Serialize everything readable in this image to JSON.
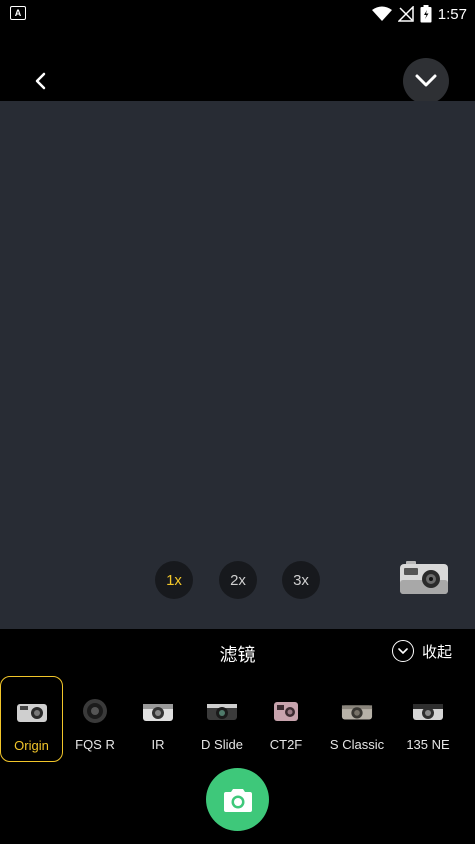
{
  "status_bar": {
    "time": "1:57",
    "left_badge": "A"
  },
  "zoom": {
    "options": [
      "1x",
      "2x",
      "3x"
    ],
    "selected": "1x"
  },
  "panel": {
    "title": "滤镜",
    "collapse_label": "收起"
  },
  "filters": [
    {
      "label": "Origin",
      "selected": true
    },
    {
      "label": "FQS R"
    },
    {
      "label": "IR"
    },
    {
      "label": "D Slide"
    },
    {
      "label": "CT2F"
    },
    {
      "label": "S Classic"
    },
    {
      "label": "135 NE"
    }
  ],
  "colors": {
    "accent": "#f2c62a",
    "shutter": "#3ec87a",
    "viewfinder": "#282c34"
  }
}
